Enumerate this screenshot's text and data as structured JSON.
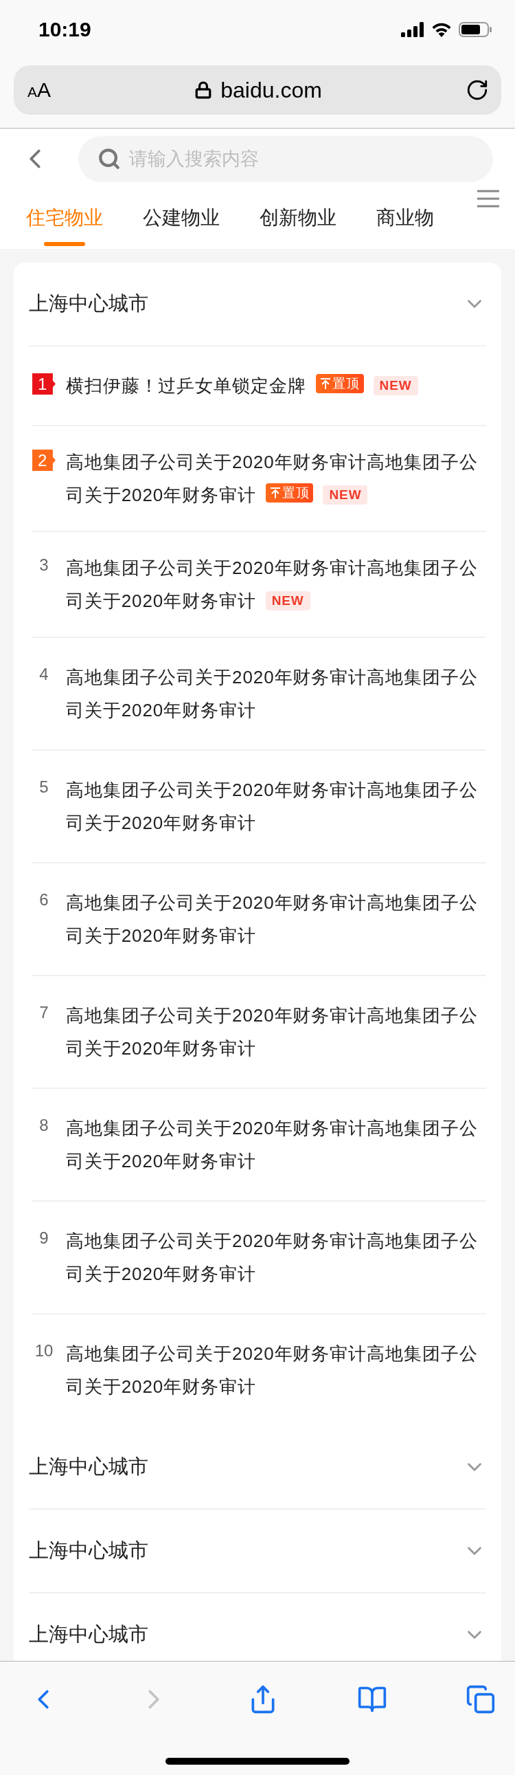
{
  "status_bar": {
    "time": "10:19"
  },
  "address_bar": {
    "text_size_label": "AA",
    "url": "baidu.com"
  },
  "search": {
    "placeholder": "请输入搜索内容"
  },
  "tabs": [
    {
      "label": "住宅物业",
      "selected": true
    },
    {
      "label": "公建物业",
      "selected": false
    },
    {
      "label": "创新物业",
      "selected": false
    },
    {
      "label": "商业物",
      "selected": false
    }
  ],
  "sections": [
    {
      "title": "上海中心城市",
      "items": [
        {
          "rank": "1",
          "kind": "first",
          "text": "横扫伊藤！过乒女单锁定金牌",
          "tags": [
            {
              "kind": "pinned",
              "label": "置顶"
            },
            {
              "kind": "new",
              "label": "NEW"
            }
          ]
        },
        {
          "rank": "2",
          "kind": "second",
          "text": "高地集团子公司关于2020年财务审计高地集团子公司关于2020年财务审计",
          "tags": [
            {
              "kind": "pinned",
              "label": "置顶"
            },
            {
              "kind": "new",
              "label": "NEW"
            }
          ]
        },
        {
          "rank": "3",
          "kind": "normal",
          "text": "高地集团子公司关于2020年财务审计高地集团子公司关于2020年财务审计",
          "tags": [
            {
              "kind": "new",
              "label": "NEW"
            }
          ]
        },
        {
          "rank": "4",
          "kind": "normal",
          "text": "高地集团子公司关于2020年财务审计高地集团子公司关于2020年财务审计"
        },
        {
          "rank": "5",
          "kind": "normal",
          "text": "高地集团子公司关于2020年财务审计高地集团子公司关于2020年财务审计"
        },
        {
          "rank": "6",
          "kind": "normal",
          "text": "高地集团子公司关于2020年财务审计高地集团子公司关于2020年财务审计"
        },
        {
          "rank": "7",
          "kind": "normal",
          "text": "高地集团子公司关于2020年财务审计高地集团子公司关于2020年财务审计"
        },
        {
          "rank": "8",
          "kind": "normal",
          "text": "高地集团子公司关于2020年财务审计高地集团子公司关于2020年财务审计"
        },
        {
          "rank": "9",
          "kind": "normal",
          "text": "高地集团子公司关于2020年财务审计高地集团子公司关于2020年财务审计"
        },
        {
          "rank": "10",
          "kind": "normal",
          "text": "高地集团子公司关于2020年财务审计高地集团子公司关于2020年财务审计"
        }
      ]
    },
    {
      "title": "上海中心城市"
    },
    {
      "title": "上海中心城市"
    },
    {
      "title": "上海中心城市"
    }
  ],
  "toolbar": [
    {
      "kind": "back",
      "disabled": false
    },
    {
      "kind": "forward",
      "disabled": true
    },
    {
      "kind": "share",
      "disabled": false
    },
    {
      "kind": "bookmarks",
      "disabled": false
    },
    {
      "kind": "tabs",
      "disabled": false
    }
  ]
}
